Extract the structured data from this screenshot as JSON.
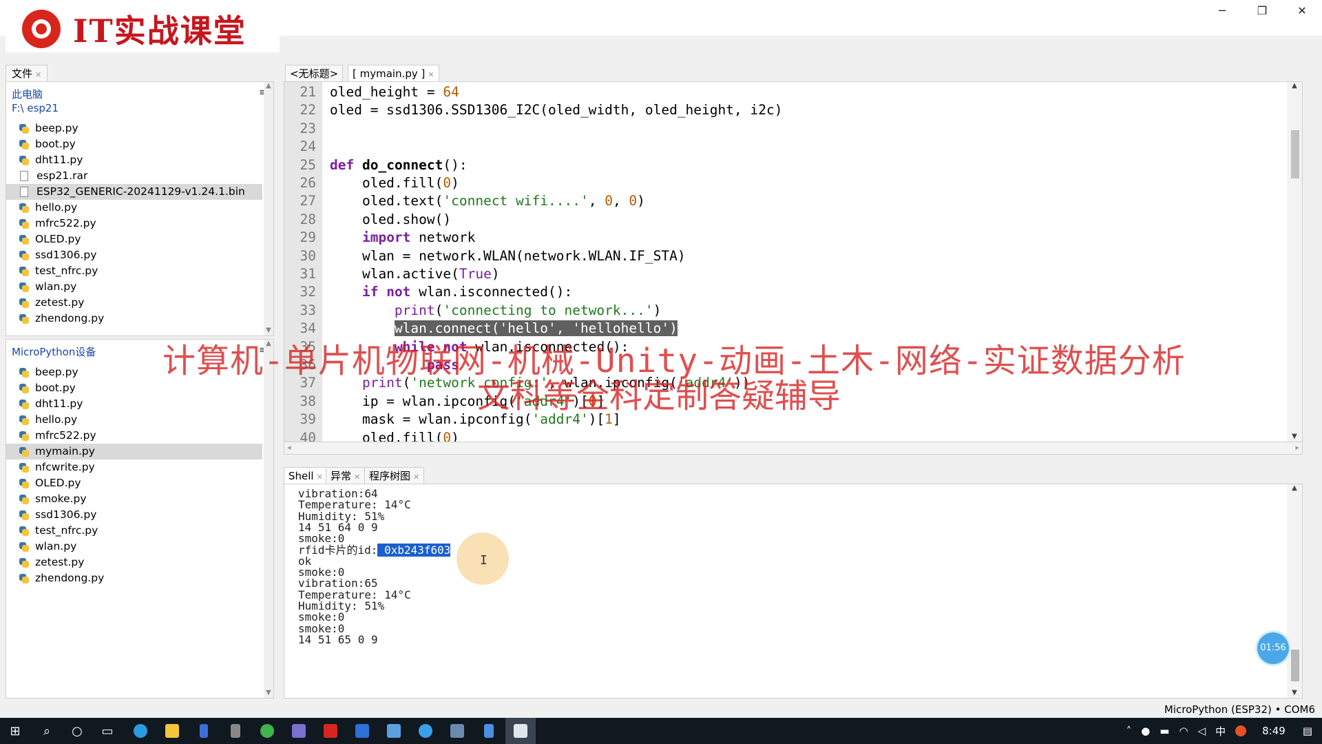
{
  "logo": {
    "text": "IT实战课堂"
  },
  "window_controls": {
    "minimize": "─",
    "maximize": "❐",
    "close": "✕"
  },
  "files_pane": {
    "tab_label": "文件",
    "local": {
      "header": "此电脑",
      "path": "F:\\ esp21",
      "items": [
        {
          "name": "beep.py",
          "type": "py"
        },
        {
          "name": "boot.py",
          "type": "py"
        },
        {
          "name": "dht11.py",
          "type": "py"
        },
        {
          "name": "esp21.rar",
          "type": "file"
        },
        {
          "name": "ESP32_GENERIC-20241129-v1.24.1.bin",
          "type": "file"
        },
        {
          "name": "hello.py",
          "type": "py"
        },
        {
          "name": "mfrc522.py",
          "type": "py"
        },
        {
          "name": "OLED.py",
          "type": "py"
        },
        {
          "name": "ssd1306.py",
          "type": "py"
        },
        {
          "name": "test_nfrc.py",
          "type": "py"
        },
        {
          "name": "wlan.py",
          "type": "py"
        },
        {
          "name": "zetest.py",
          "type": "py"
        },
        {
          "name": "zhendong.py",
          "type": "py"
        }
      ],
      "selected_index": 4
    },
    "device": {
      "header": "MicroPython设备",
      "items": [
        {
          "name": "beep.py",
          "type": "py"
        },
        {
          "name": "boot.py",
          "type": "py"
        },
        {
          "name": "dht11.py",
          "type": "py"
        },
        {
          "name": "hello.py",
          "type": "py"
        },
        {
          "name": "mfrc522.py",
          "type": "py"
        },
        {
          "name": "mymain.py",
          "type": "py"
        },
        {
          "name": "nfcwrite.py",
          "type": "py"
        },
        {
          "name": "OLED.py",
          "type": "py"
        },
        {
          "name": "smoke.py",
          "type": "py"
        },
        {
          "name": "ssd1306.py",
          "type": "py"
        },
        {
          "name": "test_nfrc.py",
          "type": "py"
        },
        {
          "name": "wlan.py",
          "type": "py"
        },
        {
          "name": "zetest.py",
          "type": "py"
        },
        {
          "name": "zhendong.py",
          "type": "py"
        }
      ],
      "selected_index": 5
    }
  },
  "editor": {
    "tabs": [
      "<无标题>",
      "[ mymain.py ]"
    ],
    "active_tab": 1,
    "lines": [
      {
        "n": "21",
        "t": [
          [
            "oled_height = ",
            ""
          ],
          [
            "64",
            "num"
          ]
        ]
      },
      {
        "n": "22",
        "t": [
          [
            "oled = ssd1306.SSD1306_I2C(oled_width, oled_height, i2c)",
            ""
          ]
        ]
      },
      {
        "n": "23",
        "t": []
      },
      {
        "n": "24",
        "t": []
      },
      {
        "n": "25",
        "t": [
          [
            "def",
            "kw"
          ],
          [
            " ",
            ""
          ],
          [
            "do_connect",
            "kwn"
          ],
          [
            "():",
            ""
          ]
        ]
      },
      {
        "n": "26",
        "t": [
          [
            "    oled.fill(",
            ""
          ],
          [
            "0",
            "num"
          ],
          [
            ")",
            ""
          ]
        ]
      },
      {
        "n": "27",
        "t": [
          [
            "    oled.text(",
            ""
          ],
          [
            "'connect wifi....'",
            "str"
          ],
          [
            ", ",
            ""
          ],
          [
            "0",
            "num"
          ],
          [
            ", ",
            ""
          ],
          [
            "0",
            "num"
          ],
          [
            ")",
            ""
          ]
        ]
      },
      {
        "n": "28",
        "t": [
          [
            "    oled.show()",
            ""
          ]
        ]
      },
      {
        "n": "29",
        "t": [
          [
            "    ",
            ""
          ],
          [
            "import",
            "kw"
          ],
          [
            " network",
            ""
          ]
        ]
      },
      {
        "n": "30",
        "t": [
          [
            "    wlan = network.WLAN(network.WLAN.IF_STA)",
            ""
          ]
        ]
      },
      {
        "n": "31",
        "t": [
          [
            "    wlan.active(",
            ""
          ],
          [
            "True",
            "builtin"
          ],
          [
            ")",
            ""
          ]
        ]
      },
      {
        "n": "32",
        "t": [
          [
            "    ",
            ""
          ],
          [
            "if",
            "kw"
          ],
          [
            " ",
            ""
          ],
          [
            "not",
            "kw"
          ],
          [
            " wlan.isconnected():",
            ""
          ]
        ]
      },
      {
        "n": "33",
        "t": [
          [
            "        ",
            ""
          ],
          [
            "print",
            "builtin"
          ],
          [
            "(",
            ""
          ],
          [
            "'connecting to network...'",
            "str"
          ],
          [
            ")",
            ""
          ]
        ]
      },
      {
        "n": "34",
        "t": [
          [
            "        ",
            ""
          ],
          [
            "wlan.connect('hello', 'hellohello')",
            "sel"
          ]
        ]
      },
      {
        "n": "35",
        "t": [
          [
            "        ",
            ""
          ],
          [
            "while",
            "kw"
          ],
          [
            " ",
            ""
          ],
          [
            "not",
            "kw"
          ],
          [
            " wlan.isconnected():",
            ""
          ]
        ]
      },
      {
        "n": "36",
        "t": [
          [
            "            ",
            ""
          ],
          [
            "pass",
            "kw"
          ]
        ]
      },
      {
        "n": "37",
        "t": [
          [
            "    ",
            ""
          ],
          [
            "print",
            "builtin"
          ],
          [
            "(",
            ""
          ],
          [
            "'network config:'",
            "str"
          ],
          [
            ", wlan.ipconfig(",
            ""
          ],
          [
            "'addr4'",
            "str"
          ],
          [
            "))",
            ""
          ]
        ]
      },
      {
        "n": "38",
        "t": [
          [
            "    ip = wlan.ipconfig(",
            ""
          ],
          [
            "'addr4'",
            "str"
          ],
          [
            ")[",
            ""
          ],
          [
            "0",
            "num"
          ],
          [
            "]",
            ""
          ]
        ]
      },
      {
        "n": "39",
        "t": [
          [
            "    mask = wlan.ipconfig(",
            ""
          ],
          [
            "'addr4'",
            "str"
          ],
          [
            ")[",
            ""
          ],
          [
            "1",
            "num"
          ],
          [
            "]",
            ""
          ]
        ]
      },
      {
        "n": "40",
        "t": [
          [
            "    oled.fill(",
            ""
          ],
          [
            "0",
            "num"
          ],
          [
            ")",
            ""
          ]
        ]
      }
    ]
  },
  "shell_tabs": [
    "Shell",
    "异常",
    "程序树图"
  ],
  "shell": {
    "lines": [
      "vibration:64",
      "Temperature: 14°C",
      "Humidity: 51%",
      "14 51 64 0 9",
      "smoke:0",
      "rfid卡片的id:",
      "ok",
      "smoke:0",
      "vibration:65",
      "Temperature: 14°C",
      "Humidity: 51%",
      "smoke:0",
      "smoke:0",
      "14 51 65 0 9"
    ],
    "selected_value": " 0xb243f603",
    "selected_line_index": 5
  },
  "overlay": {
    "line1": "计算机-单片机物联网-机械-Unity-动画-土木-网络-实证数据分析",
    "line2": "文科等全科定制答疑辅导"
  },
  "timer": "01:56",
  "status": {
    "interpreter": "MicroPython (ESP32)  •  COM6"
  },
  "taskbar": {
    "clock": "8:49",
    "ime": "中"
  },
  "colors": {
    "keyword": "#7a1fa2",
    "string": "#1d7a1d",
    "number": "#b35c00",
    "selection": "#1a5fd1",
    "overlay_text": "#d61e1e"
  }
}
